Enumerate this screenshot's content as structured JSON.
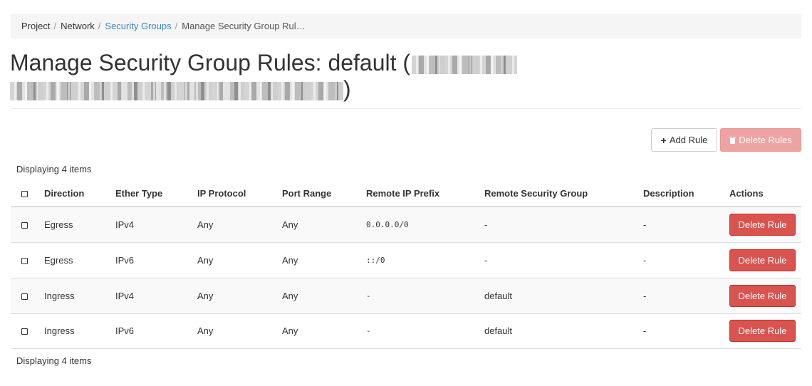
{
  "breadcrumb": {
    "items": [
      {
        "label": "Project"
      },
      {
        "label": "Network"
      },
      {
        "label": "Security Groups"
      },
      {
        "label": "Manage Security Group Rul…"
      }
    ],
    "separator": "/"
  },
  "page": {
    "title": "Manage Security Group Rules: default (",
    "title_close": ")"
  },
  "toolbar": {
    "add_label": "Add Rule",
    "delete_label": "Delete Rules"
  },
  "table": {
    "count_text": "Displaying 4 items",
    "columns": [
      "Direction",
      "Ether Type",
      "IP Protocol",
      "Port Range",
      "Remote IP Prefix",
      "Remote Security Group",
      "Description",
      "Actions"
    ],
    "rows": [
      {
        "direction": "Egress",
        "ether_type": "IPv4",
        "ip_protocol": "Any",
        "port_range": "Any",
        "remote_ip_prefix": "0.0.0.0/0",
        "remote_security_group": "-",
        "description": "-",
        "action": "Delete Rule"
      },
      {
        "direction": "Egress",
        "ether_type": "IPv6",
        "ip_protocol": "Any",
        "port_range": "Any",
        "remote_ip_prefix": "::/0",
        "remote_security_group": "-",
        "description": "-",
        "action": "Delete Rule"
      },
      {
        "direction": "Ingress",
        "ether_type": "IPv4",
        "ip_protocol": "Any",
        "port_range": "Any",
        "remote_ip_prefix": "-",
        "remote_security_group": "default",
        "description": "-",
        "action": "Delete Rule"
      },
      {
        "direction": "Ingress",
        "ether_type": "IPv6",
        "ip_protocol": "Any",
        "port_range": "Any",
        "remote_ip_prefix": "-",
        "remote_security_group": "default",
        "description": "-",
        "action": "Delete Rule"
      }
    ]
  },
  "colors": {
    "link": "#3a87c8",
    "danger": "#d9534f",
    "danger_disabled": "#eda3a2",
    "breadcrumb_bg": "#f5f5f5"
  },
  "icons": {
    "add": "plus-icon",
    "delete": "trash-icon"
  }
}
